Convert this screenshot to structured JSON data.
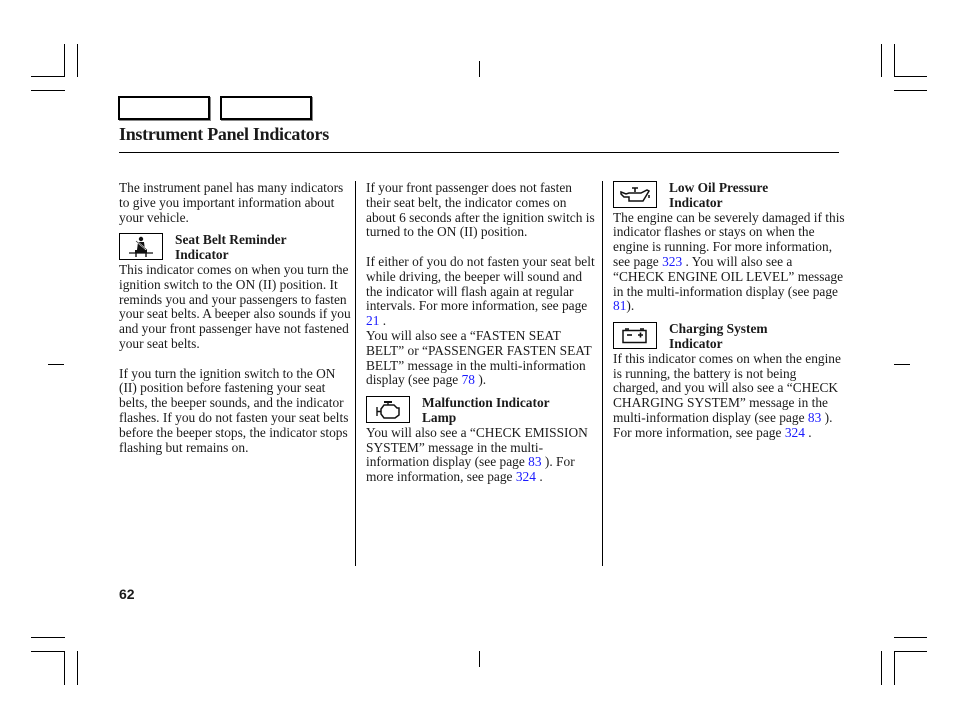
{
  "header": {
    "title": "Instrument Panel Indicators"
  },
  "intro": "The instrument panel has many indicators to give you important information about your vehicle.",
  "seat_belt": {
    "icon": "seat-belt-icon",
    "heading_line1": "Seat Belt Reminder",
    "heading_line2": "Indicator",
    "para1": "This indicator comes on when you turn the ignition switch to the ON (II) position. It reminds you and your passengers to fasten your seat belts. A beeper also sounds if you and your front passenger have not fastened your seat belts.",
    "para2": "If you turn the ignition switch to the ON (II) position before fastening your seat belts, the beeper sounds, and the indicator flashes. If you do not fasten your seat belts before the beeper stops, the indicator stops flashing but remains on.",
    "para3": "If your front passenger does not fasten their seat belt, the indicator comes on about 6 seconds after the ignition switch is turned to the ON (II) position.",
    "para4_pre": "If either of you do not fasten your seat belt while driving, the beeper will sound and the indicator will flash again at regular intervals. For more information, see page",
    "para4_link": "21",
    "para4_post": ".",
    "para5_pre": "You will also see a “FASTEN SEAT BELT” or “PASSENGER FASTEN SEAT BELT” message in the multi-information display (see page",
    "para5_link": "78",
    "para5_post": ")."
  },
  "malfunction": {
    "icon": "check-engine-icon",
    "heading_line1": "Malfunction Indicator",
    "heading_line2": "Lamp",
    "text_pre": "You will also see a “CHECK EMISSION SYSTEM” message in the multi-information display (see page",
    "link1": "83",
    "text_mid": "). For more information, see page",
    "link2": "324",
    "text_post": "."
  },
  "oil_pressure": {
    "icon": "oil-can-icon",
    "heading_line1": "Low Oil Pressure",
    "heading_line2": "Indicator",
    "text_pre": "The engine can be severely damaged if this indicator flashes or stays on when the engine is running. For more information, see page",
    "link1": "323",
    "text_mid": ". You will also see a “CHECK ENGINE OIL LEVEL” message in the multi-information display (see page",
    "link2": "81",
    "text_post": ")."
  },
  "charging": {
    "icon": "battery-icon",
    "heading_line1": "Charging System",
    "heading_line2": "Indicator",
    "text_pre": "If this indicator comes on when the engine is running, the battery is not being charged, and you will also see a “CHECK CHARGING SYSTEM” message in the multi-information display (see page",
    "link1": "83",
    "text_mid": "). For more information, see page",
    "link2": "324",
    "text_post": "."
  },
  "footer": {
    "page_number": "62"
  },
  "colors": {
    "link": "#1a1aff",
    "text": "#1a1a1a"
  }
}
